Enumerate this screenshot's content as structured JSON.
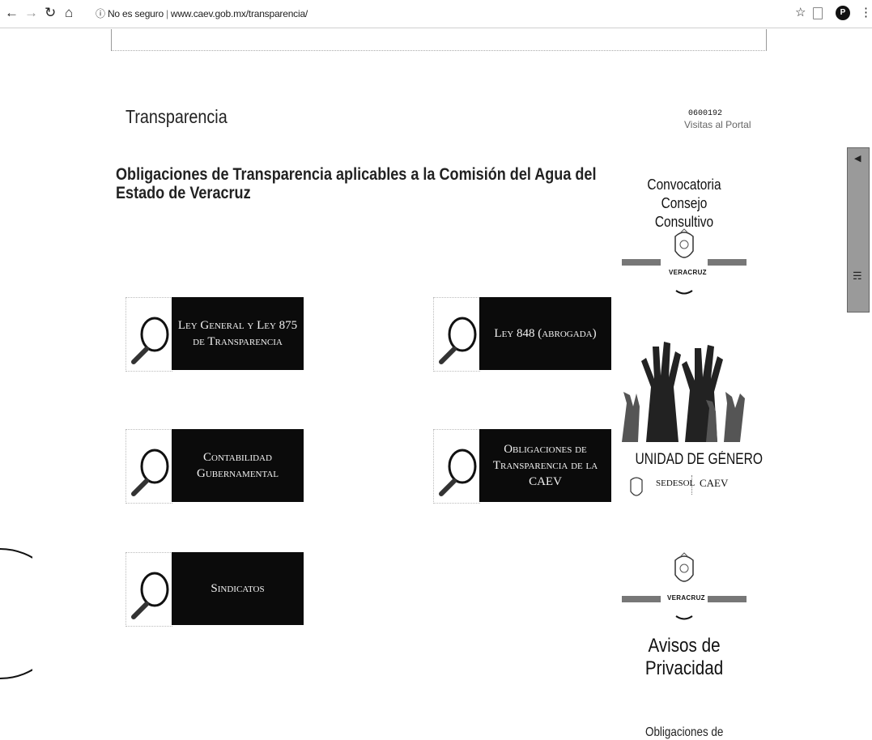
{
  "browser": {
    "security_label": "No es seguro",
    "url": "www.caev.gob.mx/transparencia/",
    "profile_initial": "P"
  },
  "page": {
    "title": "Transparencia",
    "subtitle": "Obligaciones de Transparencia aplicables a la Comisión del Agua del Estado de Veracruz"
  },
  "counter": {
    "value": "0600192",
    "label": "Visitas al Portal"
  },
  "cards": [
    {
      "label": "Ley General y Ley 875 de Transparencia"
    },
    {
      "label": "Ley 848 (abrogada)"
    },
    {
      "label": "Contabilidad Gubernamental"
    },
    {
      "label": "Obligaciones de Transparencia de la CAEV"
    },
    {
      "label": "Sindicatos"
    }
  ],
  "sidebar": {
    "consejo_title": "Convocatoria Consejo Consultivo",
    "veracruz_label": "VERACRUZ",
    "genero_title": "UNIDAD DE GÉNERO",
    "sedesol": "SEDESOL",
    "caev": "CAEV",
    "privacidad_title": "Avisos de Privacidad",
    "obligaciones_partial": "Obligaciones de"
  },
  "colors": {
    "card_bg": "#0b0b0b",
    "card_text": "#f2f2f2",
    "tab_bg": "#9a9a9a"
  }
}
